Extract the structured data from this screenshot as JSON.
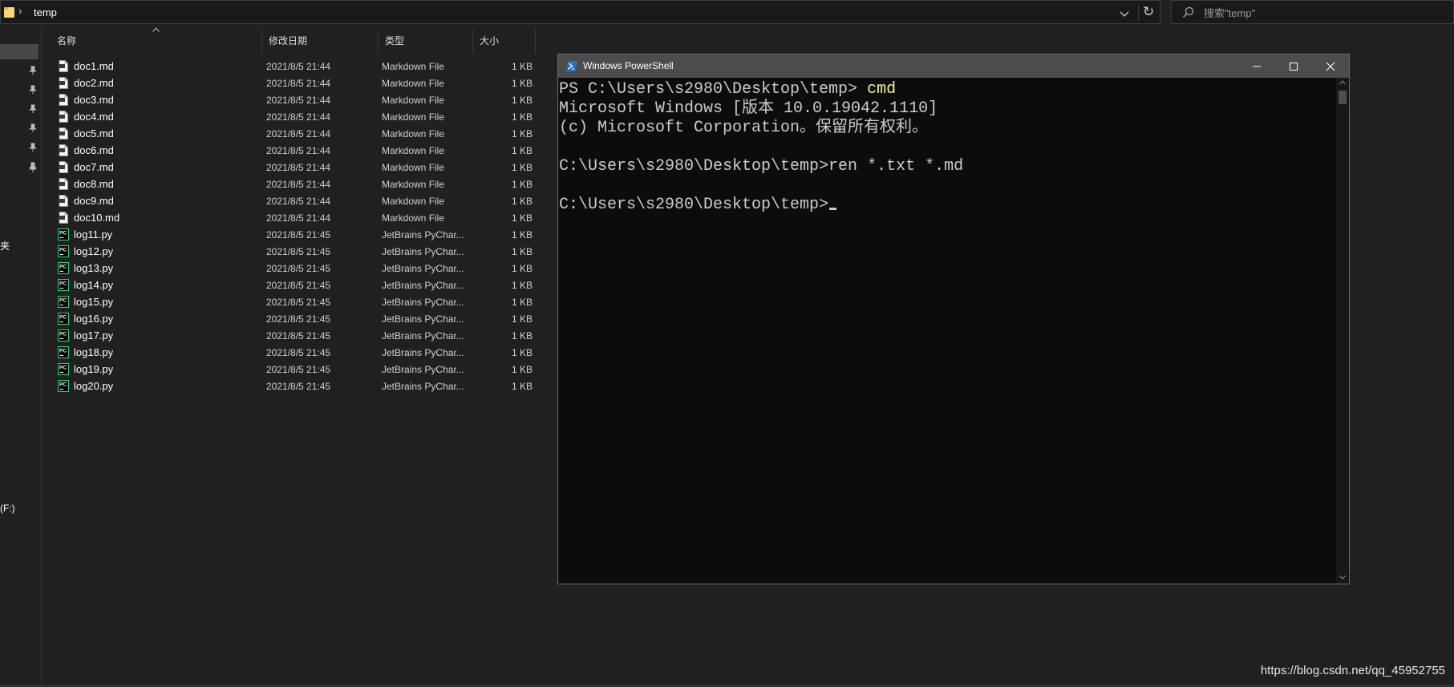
{
  "address_bar": {
    "crumbs": [
      "temp"
    ],
    "refresh_glyph": "↻"
  },
  "search": {
    "placeholder": "搜索\"temp\""
  },
  "nav_pane": {
    "pinned_count": 7,
    "clipped_labels": [
      "夹",
      "(F:)"
    ]
  },
  "file_list": {
    "columns": [
      "名称",
      "修改日期",
      "类型",
      "大小"
    ],
    "sort_column": "名称",
    "files": [
      {
        "name": "doc1.md",
        "date": "2021/8/5 21:44",
        "type": "Markdown File",
        "size": "1 KB",
        "icon": "markdown-file-icon"
      },
      {
        "name": "doc2.md",
        "date": "2021/8/5 21:44",
        "type": "Markdown File",
        "size": "1 KB",
        "icon": "markdown-file-icon"
      },
      {
        "name": "doc3.md",
        "date": "2021/8/5 21:44",
        "type": "Markdown File",
        "size": "1 KB",
        "icon": "markdown-file-icon"
      },
      {
        "name": "doc4.md",
        "date": "2021/8/5 21:44",
        "type": "Markdown File",
        "size": "1 KB",
        "icon": "markdown-file-icon"
      },
      {
        "name": "doc5.md",
        "date": "2021/8/5 21:44",
        "type": "Markdown File",
        "size": "1 KB",
        "icon": "markdown-file-icon"
      },
      {
        "name": "doc6.md",
        "date": "2021/8/5 21:44",
        "type": "Markdown File",
        "size": "1 KB",
        "icon": "markdown-file-icon"
      },
      {
        "name": "doc7.md",
        "date": "2021/8/5 21:44",
        "type": "Markdown File",
        "size": "1 KB",
        "icon": "markdown-file-icon"
      },
      {
        "name": "doc8.md",
        "date": "2021/8/5 21:44",
        "type": "Markdown File",
        "size": "1 KB",
        "icon": "markdown-file-icon"
      },
      {
        "name": "doc9.md",
        "date": "2021/8/5 21:44",
        "type": "Markdown File",
        "size": "1 KB",
        "icon": "markdown-file-icon"
      },
      {
        "name": "doc10.md",
        "date": "2021/8/5 21:44",
        "type": "Markdown File",
        "size": "1 KB",
        "icon": "markdown-file-icon"
      },
      {
        "name": "log11.py",
        "date": "2021/8/5 21:45",
        "type": "JetBrains PyChar...",
        "size": "1 KB",
        "icon": "pycharm-file-icon"
      },
      {
        "name": "log12.py",
        "date": "2021/8/5 21:45",
        "type": "JetBrains PyChar...",
        "size": "1 KB",
        "icon": "pycharm-file-icon"
      },
      {
        "name": "log13.py",
        "date": "2021/8/5 21:45",
        "type": "JetBrains PyChar...",
        "size": "1 KB",
        "icon": "pycharm-file-icon"
      },
      {
        "name": "log14.py",
        "date": "2021/8/5 21:45",
        "type": "JetBrains PyChar...",
        "size": "1 KB",
        "icon": "pycharm-file-icon"
      },
      {
        "name": "log15.py",
        "date": "2021/8/5 21:45",
        "type": "JetBrains PyChar...",
        "size": "1 KB",
        "icon": "pycharm-file-icon"
      },
      {
        "name": "log16.py",
        "date": "2021/8/5 21:45",
        "type": "JetBrains PyChar...",
        "size": "1 KB",
        "icon": "pycharm-file-icon"
      },
      {
        "name": "log17.py",
        "date": "2021/8/5 21:45",
        "type": "JetBrains PyChar...",
        "size": "1 KB",
        "icon": "pycharm-file-icon"
      },
      {
        "name": "log18.py",
        "date": "2021/8/5 21:45",
        "type": "JetBrains PyChar...",
        "size": "1 KB",
        "icon": "pycharm-file-icon"
      },
      {
        "name": "log19.py",
        "date": "2021/8/5 21:45",
        "type": "JetBrains PyChar...",
        "size": "1 KB",
        "icon": "pycharm-file-icon"
      },
      {
        "name": "log20.py",
        "date": "2021/8/5 21:45",
        "type": "JetBrains PyChar...",
        "size": "1 KB",
        "icon": "pycharm-file-icon"
      }
    ]
  },
  "powershell": {
    "title": "Windows PowerShell",
    "lines": [
      {
        "prefix": "PS C:\\Users\\s2980\\Desktop\\temp> ",
        "command": "cmd"
      },
      {
        "text": "Microsoft Windows [版本 10.0.19042.1110]"
      },
      {
        "text": "(c) Microsoft Corporation。保留所有权利。"
      },
      {
        "text": ""
      },
      {
        "text": "C:\\Users\\s2980\\Desktop\\temp>ren *.txt *.md"
      },
      {
        "text": ""
      },
      {
        "text": "C:\\Users\\s2980\\Desktop\\temp>",
        "cursor": true
      }
    ]
  },
  "watermark": "https://blog.csdn.net/qq_45952755",
  "colors": {
    "background": "#202020",
    "console_bg": "#0c0c0c",
    "console_text": "#cccccc",
    "console_command": "#f9f1a5",
    "titlebar": "#4c4c4c",
    "pycharm_green": "#21d789",
    "folder_yellow": "#f8d775"
  }
}
